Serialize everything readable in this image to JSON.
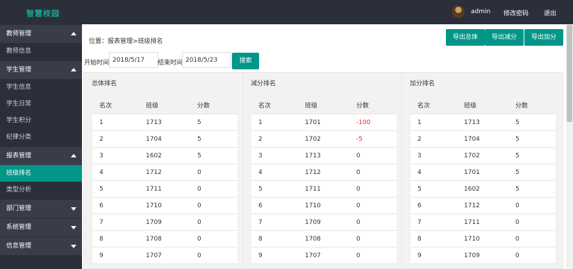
{
  "header": {
    "logo": "智慧校园",
    "username": "admin",
    "change_password": "修改密码",
    "logout": "退出"
  },
  "sidebar": {
    "groups": [
      {
        "label": "教师管理",
        "expanded": true,
        "items": [
          "教师信息"
        ]
      },
      {
        "label": "学生管理",
        "expanded": true,
        "items": [
          "学生信息",
          "学生日常",
          "学生积分",
          "纪律分类"
        ]
      },
      {
        "label": "报表管理",
        "expanded": true,
        "items": [
          "班级排名",
          "类型分析"
        ]
      },
      {
        "label": "部门管理",
        "expanded": false,
        "items": []
      },
      {
        "label": "系统管理",
        "expanded": false,
        "items": []
      },
      {
        "label": "信息管理",
        "expanded": false,
        "items": []
      }
    ],
    "active_item": "班级排名"
  },
  "breadcrumb": "位置：报表管理>班级排名",
  "toolbar": {
    "export_total": "导出总体",
    "export_minus": "导出减分",
    "export_plus": "导出加分"
  },
  "filter": {
    "start_label": "开始时间",
    "start_value": "2018/5/17",
    "end_label": "结束时间",
    "end_value": "2018/5/23",
    "search_label": "搜索"
  },
  "panels": [
    {
      "title": "总体排名",
      "columns": [
        "名次",
        "班级",
        "分数"
      ],
      "rows": [
        [
          "1",
          "1713",
          "5"
        ],
        [
          "2",
          "1704",
          "5"
        ],
        [
          "3",
          "1602",
          "5"
        ],
        [
          "4",
          "1712",
          "0"
        ],
        [
          "5",
          "1711",
          "0"
        ],
        [
          "6",
          "1710",
          "0"
        ],
        [
          "7",
          "1709",
          "0"
        ],
        [
          "8",
          "1708",
          "0"
        ],
        [
          "9",
          "1707",
          "0"
        ]
      ]
    },
    {
      "title": "减分排名",
      "columns": [
        "名次",
        "班级",
        "分数"
      ],
      "rows": [
        [
          "1",
          "1701",
          "-100"
        ],
        [
          "2",
          "1702",
          "-5"
        ],
        [
          "3",
          "1713",
          "0"
        ],
        [
          "4",
          "1712",
          "0"
        ],
        [
          "5",
          "1711",
          "0"
        ],
        [
          "6",
          "1710",
          "0"
        ],
        [
          "7",
          "1709",
          "0"
        ],
        [
          "8",
          "1708",
          "0"
        ],
        [
          "9",
          "1707",
          "0"
        ]
      ]
    },
    {
      "title": "加分排名",
      "columns": [
        "名次",
        "班级",
        "分数"
      ],
      "rows": [
        [
          "1",
          "1713",
          "5"
        ],
        [
          "2",
          "1704",
          "5"
        ],
        [
          "3",
          "1702",
          "5"
        ],
        [
          "4",
          "1701",
          "5"
        ],
        [
          "5",
          "1602",
          "5"
        ],
        [
          "6",
          "1712",
          "0"
        ],
        [
          "7",
          "1711",
          "0"
        ],
        [
          "8",
          "1710",
          "0"
        ],
        [
          "9",
          "1709",
          "0"
        ]
      ]
    }
  ],
  "colors": {
    "accent": "#009688",
    "sidebar_bg": "#2b2f3a",
    "negative": "#ee2222"
  }
}
